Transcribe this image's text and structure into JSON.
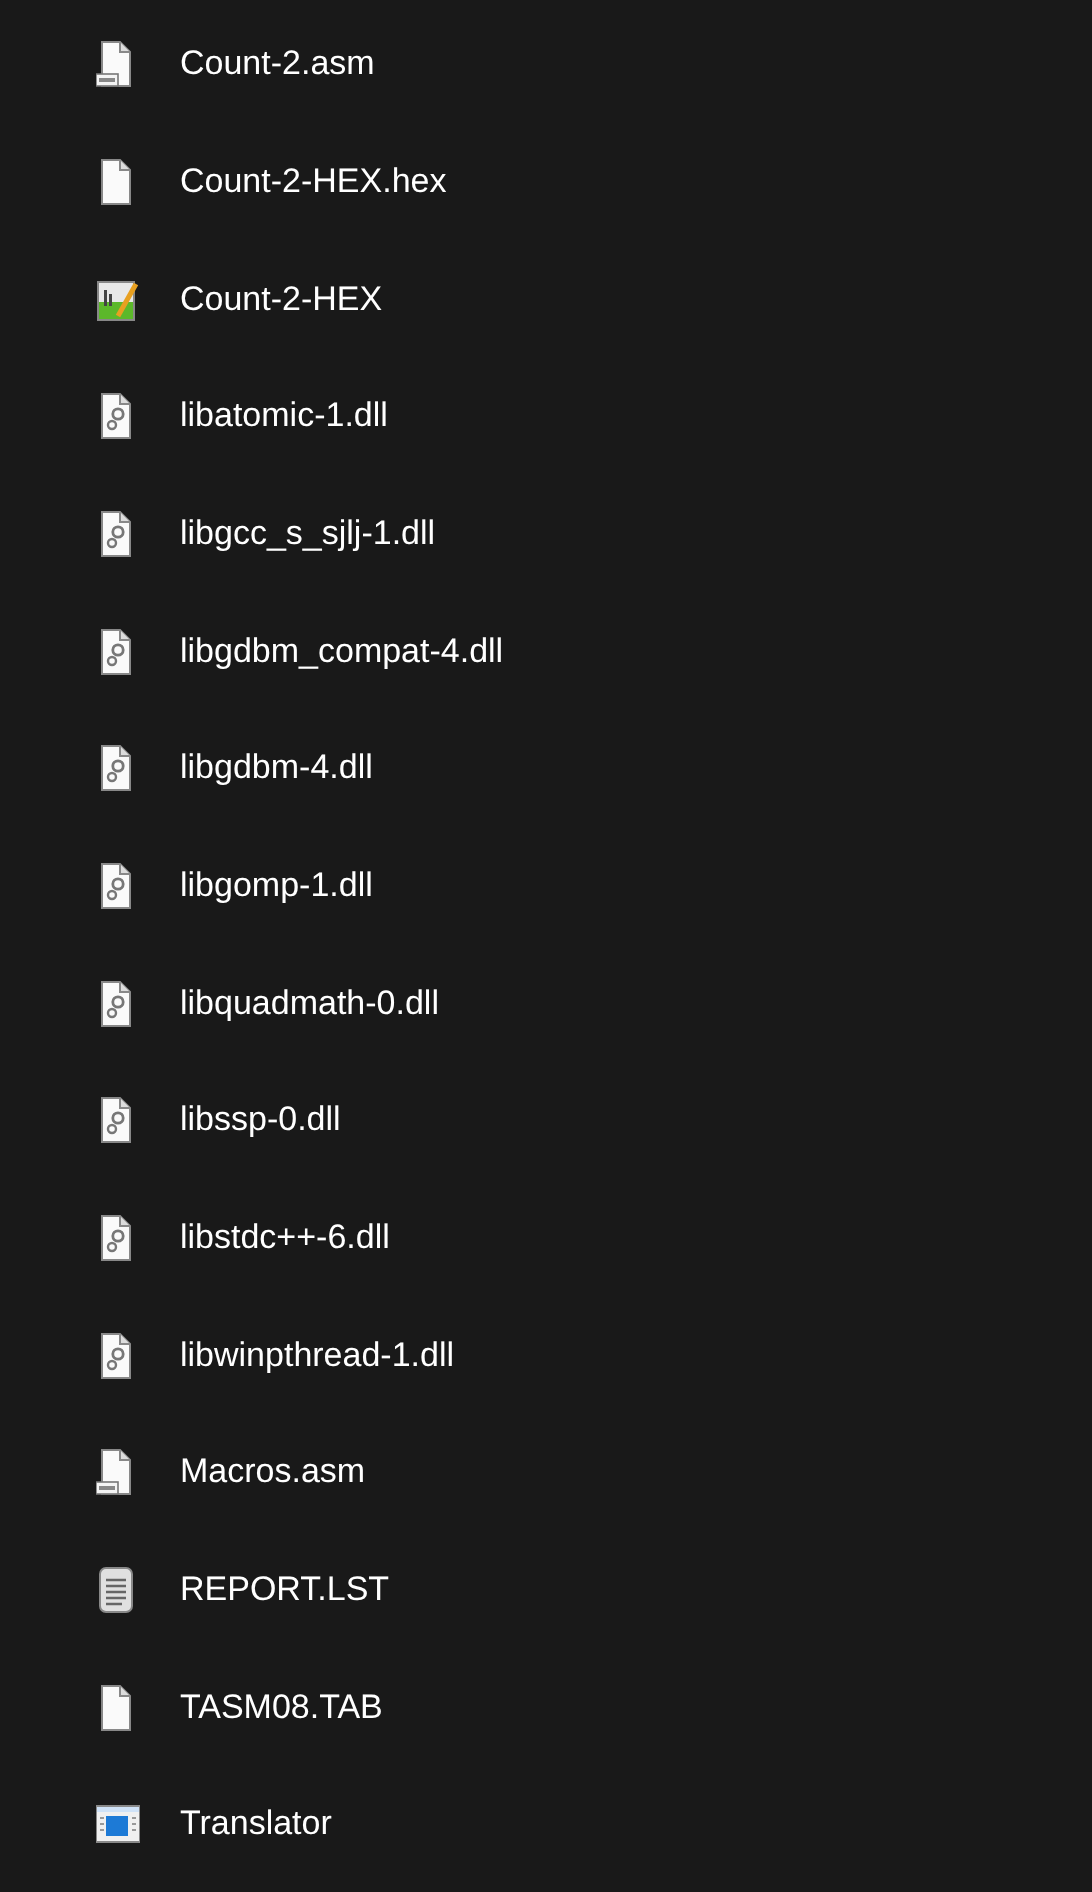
{
  "files": [
    {
      "name": "Count-2.asm",
      "kind": "asm"
    },
    {
      "name": "Count-2-HEX.hex",
      "kind": "blank"
    },
    {
      "name": "Count-2-HEX",
      "kind": "chart"
    },
    {
      "name": "libatomic-1.dll",
      "kind": "dll"
    },
    {
      "name": "libgcc_s_sjlj-1.dll",
      "kind": "dll"
    },
    {
      "name": "libgdbm_compat-4.dll",
      "kind": "dll"
    },
    {
      "name": "libgdbm-4.dll",
      "kind": "dll"
    },
    {
      "name": "libgomp-1.dll",
      "kind": "dll"
    },
    {
      "name": "libquadmath-0.dll",
      "kind": "dll"
    },
    {
      "name": "libssp-0.dll",
      "kind": "dll"
    },
    {
      "name": "libstdc++-6.dll",
      "kind": "dll"
    },
    {
      "name": "libwinpthread-1.dll",
      "kind": "dll"
    },
    {
      "name": "Macros.asm",
      "kind": "asm"
    },
    {
      "name": "REPORT.LST",
      "kind": "text"
    },
    {
      "name": "TASM08.TAB",
      "kind": "blank"
    },
    {
      "name": "Translator",
      "kind": "exe"
    }
  ]
}
